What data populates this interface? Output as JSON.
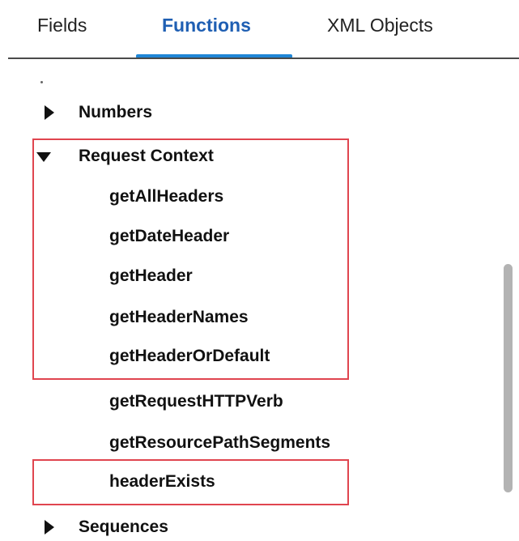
{
  "tabs": {
    "fields": "Fields",
    "functions": "Functions",
    "xml_objects": "XML Objects",
    "active": "Functions"
  },
  "tree": {
    "numbers": "Numbers",
    "request_context": "Request Context",
    "functions": [
      "getAllHeaders",
      "getDateHeader",
      "getHeader",
      "getHeaderNames",
      "getHeaderOrDefault",
      "getRequestHTTPVerb",
      "getResourcePathSegments",
      "headerExists"
    ],
    "sequences": "Sequences"
  },
  "colors": {
    "accent": "#1f86d6",
    "active_tab_text": "#1f5fb3",
    "highlight": "#e0454f"
  },
  "icons": {
    "collapsed": "caret-right-icon",
    "expanded": "caret-down-icon"
  }
}
